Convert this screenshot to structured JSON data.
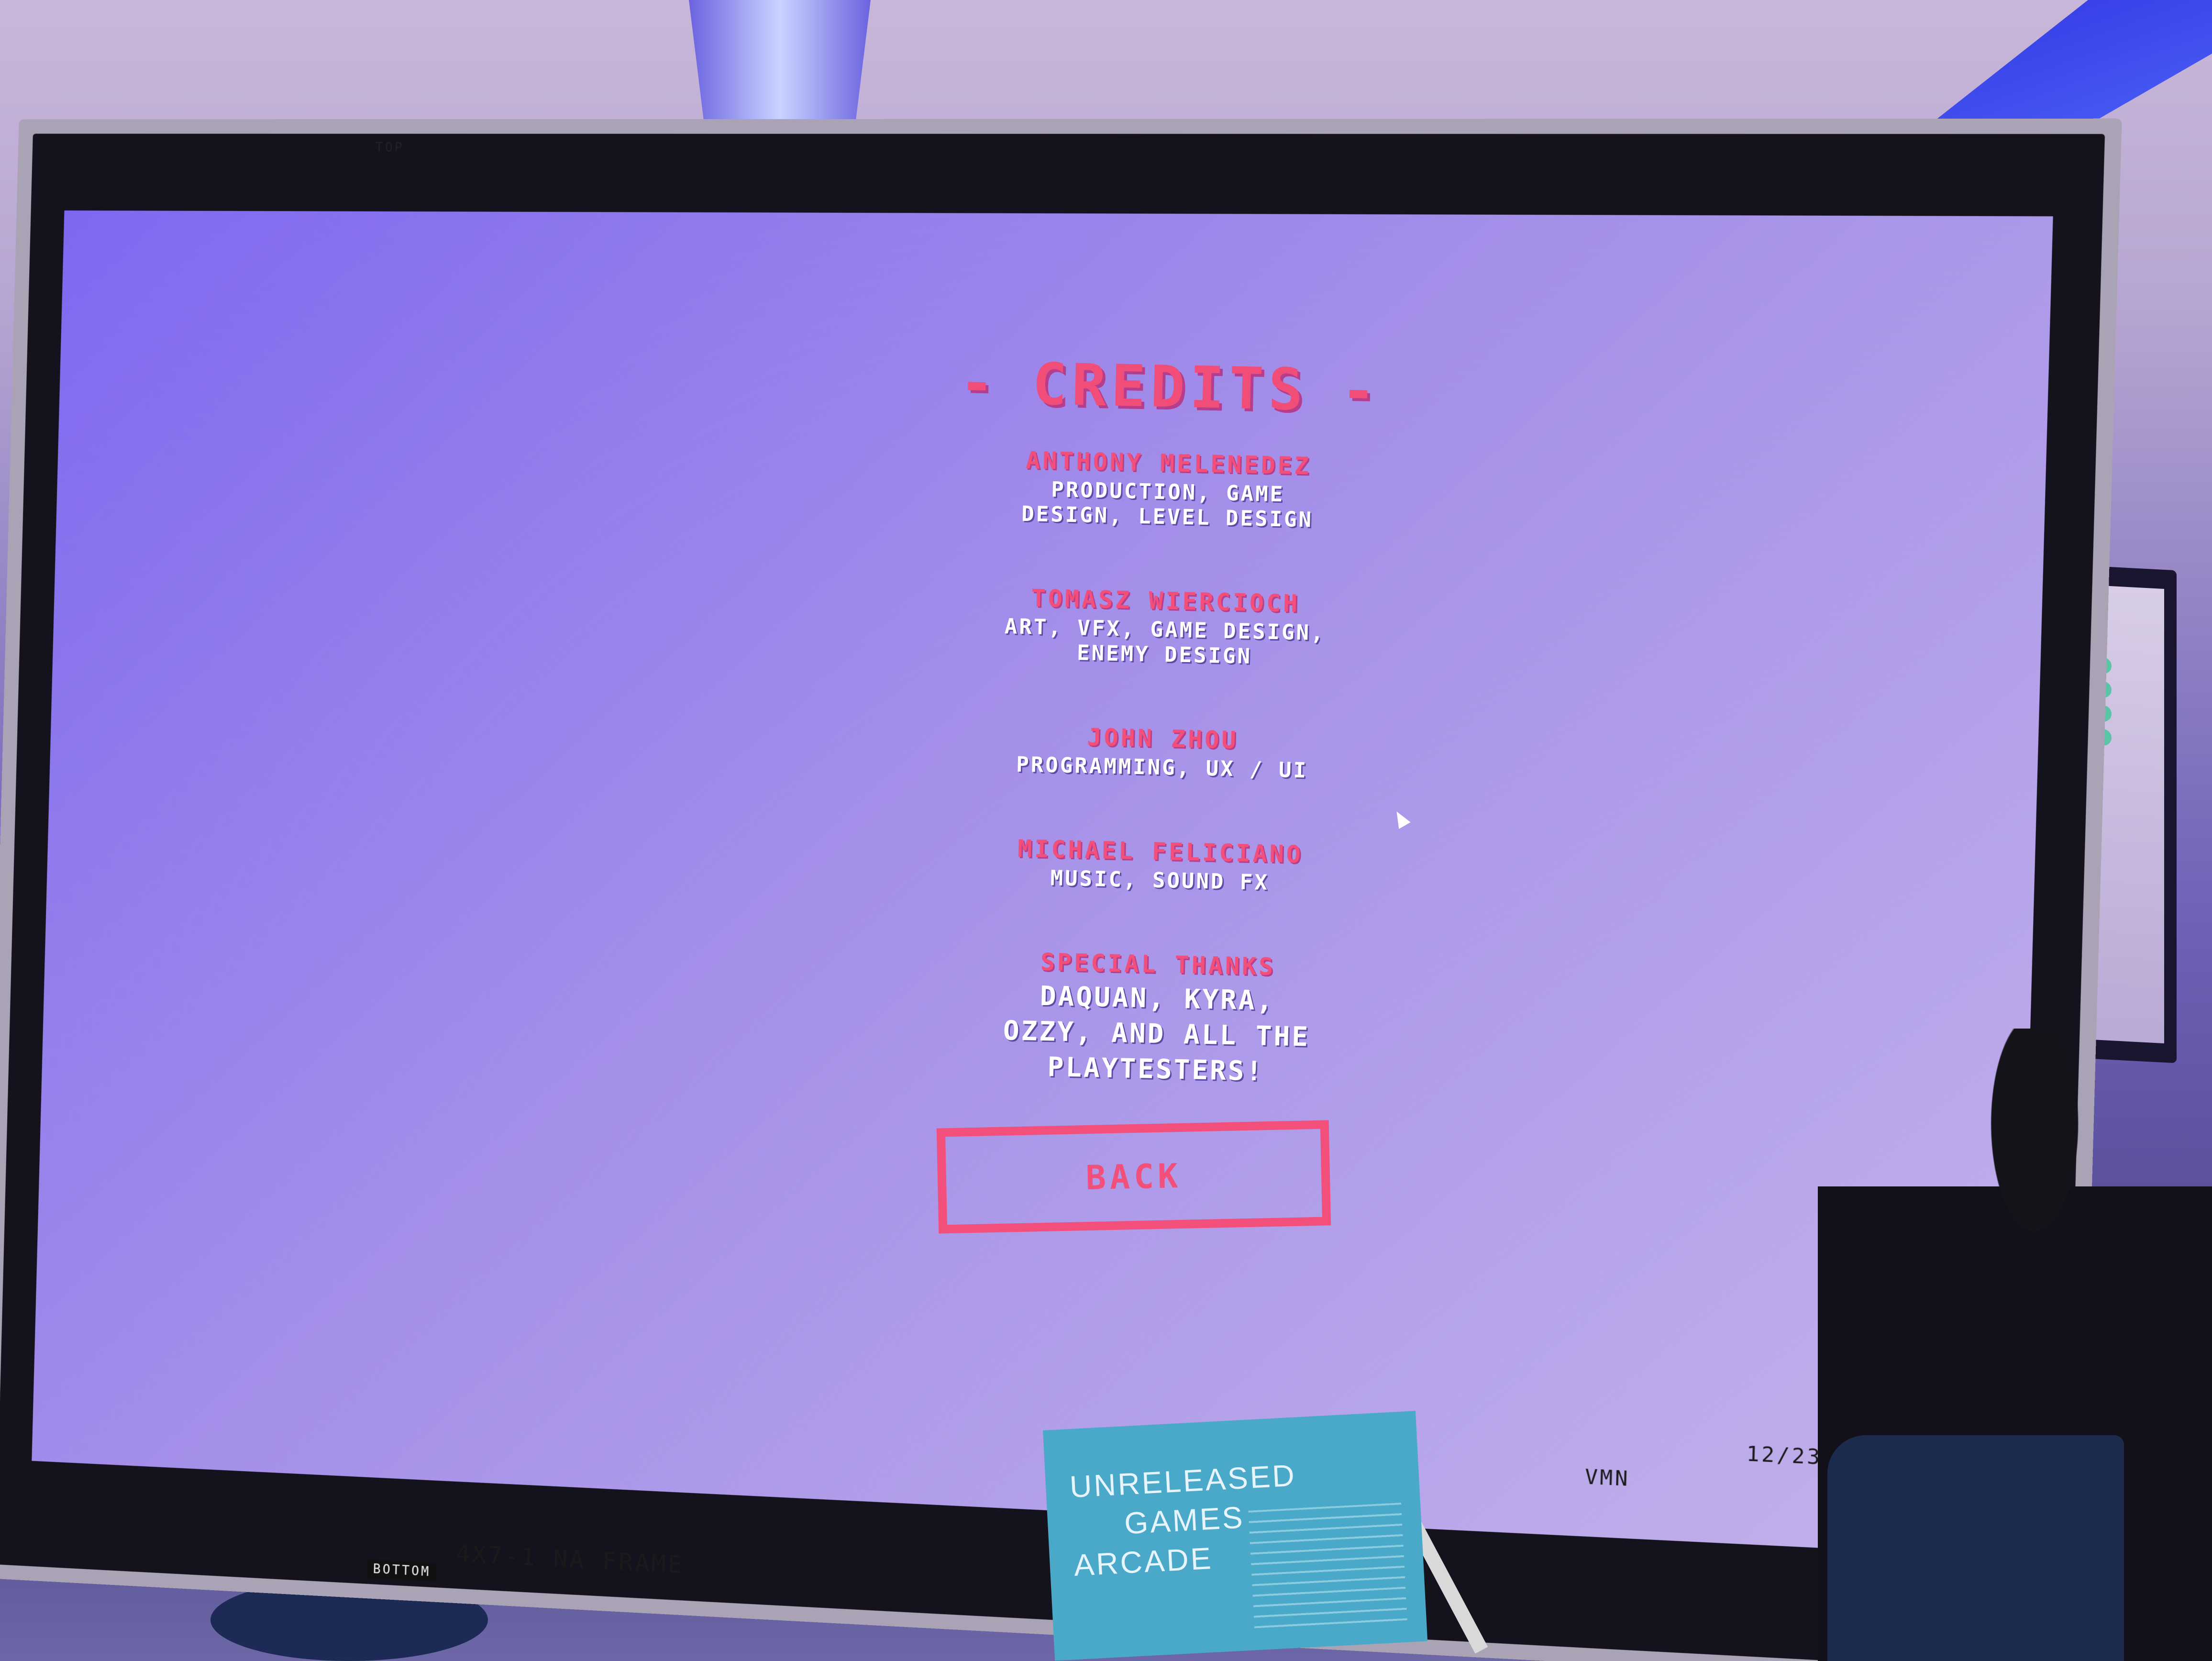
{
  "credits": {
    "title": "CREDITS",
    "title_dash": "-",
    "entries": [
      {
        "name": "ANTHONY MELENEDEZ",
        "role_line1": "PRODUCTION, GAME",
        "role_line2": "DESIGN, LEVEL DESIGN",
        "role_line3": ""
      },
      {
        "name": "TOMASZ WIERCIOCH",
        "role_line1": "ART, VFX, GAME DESIGN,",
        "role_line2": "ENEMY DESIGN",
        "role_line3": ""
      },
      {
        "name": "JOHN ZHOU",
        "role_line1": "PROGRAMMING, UX / UI",
        "role_line2": "",
        "role_line3": ""
      },
      {
        "name": "MICHAEL FELICIANO",
        "role_line1": "MUSIC, SOUND FX",
        "role_line2": "",
        "role_line3": ""
      },
      {
        "name": "SPECIAL THANKS",
        "role_line1": "DAQUAN, KYRA,",
        "role_line2": "OZZY, AND ALL THE",
        "role_line3": "PLAYTESTERS!"
      }
    ],
    "back_label": "BACK"
  },
  "frame_labels": {
    "top": "TOP",
    "bottom": "BOTTOM",
    "frame_text": "4X7-1 NA FRAME",
    "code": "VMN",
    "date": "12/23"
  },
  "sign": {
    "line1": "UNRELEASED",
    "line2": "GAMES",
    "line3": "ARCADE"
  },
  "colors": {
    "accent_pink": "#f24f7b",
    "screen_purple": "#8f7ae8",
    "text_white": "#ffffff"
  },
  "icons": {
    "cursor": "mouse-cursor-icon"
  }
}
